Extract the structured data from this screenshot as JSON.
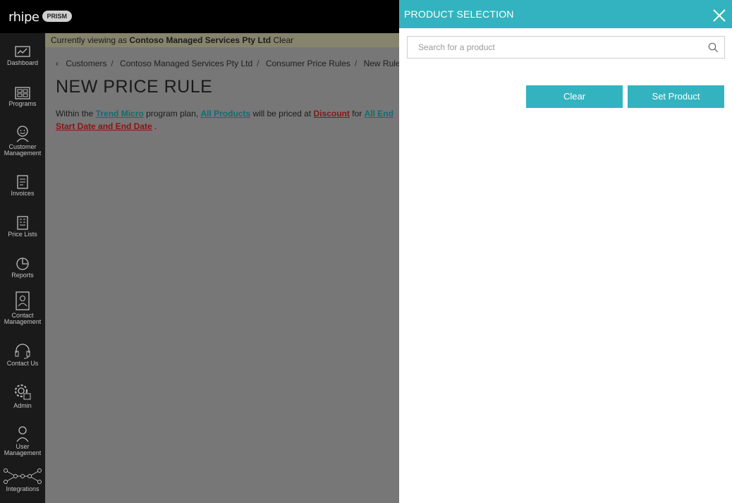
{
  "header": {
    "logo_text": "rhipe",
    "logo_badge": "PRISM"
  },
  "sidebar": {
    "items": [
      {
        "label": "Dashboard",
        "icon": "dashboard-icon"
      },
      {
        "label": "Programs",
        "icon": "programs-icon"
      },
      {
        "label": "Customer Management",
        "icon": "customer-icon"
      },
      {
        "label": "Invoices",
        "icon": "invoice-icon"
      },
      {
        "label": "Price Lists",
        "icon": "price-list-icon"
      },
      {
        "label": "Reports",
        "icon": "reports-icon"
      },
      {
        "label": "Contact Management",
        "icon": "contact-card-icon"
      },
      {
        "label": "Contact Us",
        "icon": "headset-icon"
      },
      {
        "label": "Admin",
        "icon": "admin-gear-icon"
      },
      {
        "label": "User Management",
        "icon": "user-icon"
      },
      {
        "label": "Integrations",
        "icon": "integrations-icon"
      }
    ]
  },
  "viewing": {
    "prefix": "Currently viewing as",
    "name": "Contoso Managed Services Pty Ltd",
    "clear": "Clear"
  },
  "breadcrumb": [
    "Customers",
    "Contoso Managed Services Pty Ltd",
    "Consumer Price Rules",
    "New Rule"
  ],
  "page": {
    "title": "NEW PRICE RULE"
  },
  "rule": {
    "t1": "Within the",
    "program": "Trend Micro",
    "t2": "program plan,",
    "products": "All Products",
    "t3": "will be priced at",
    "discount": "Discount",
    "t4": "for",
    "customers": "All End",
    "dates": "Start Date and End Date",
    "t5": "."
  },
  "panel": {
    "title": "PRODUCT SELECTION",
    "search_placeholder": "Search for a product",
    "search_value": "",
    "clear_label": "Clear",
    "set_label": "Set Product"
  },
  "colors": {
    "accent": "#33b3bf",
    "sidebar": "#1a1a1a",
    "topbar": "#000000",
    "link_teal": "#156a75",
    "link_red": "#8a1414"
  }
}
